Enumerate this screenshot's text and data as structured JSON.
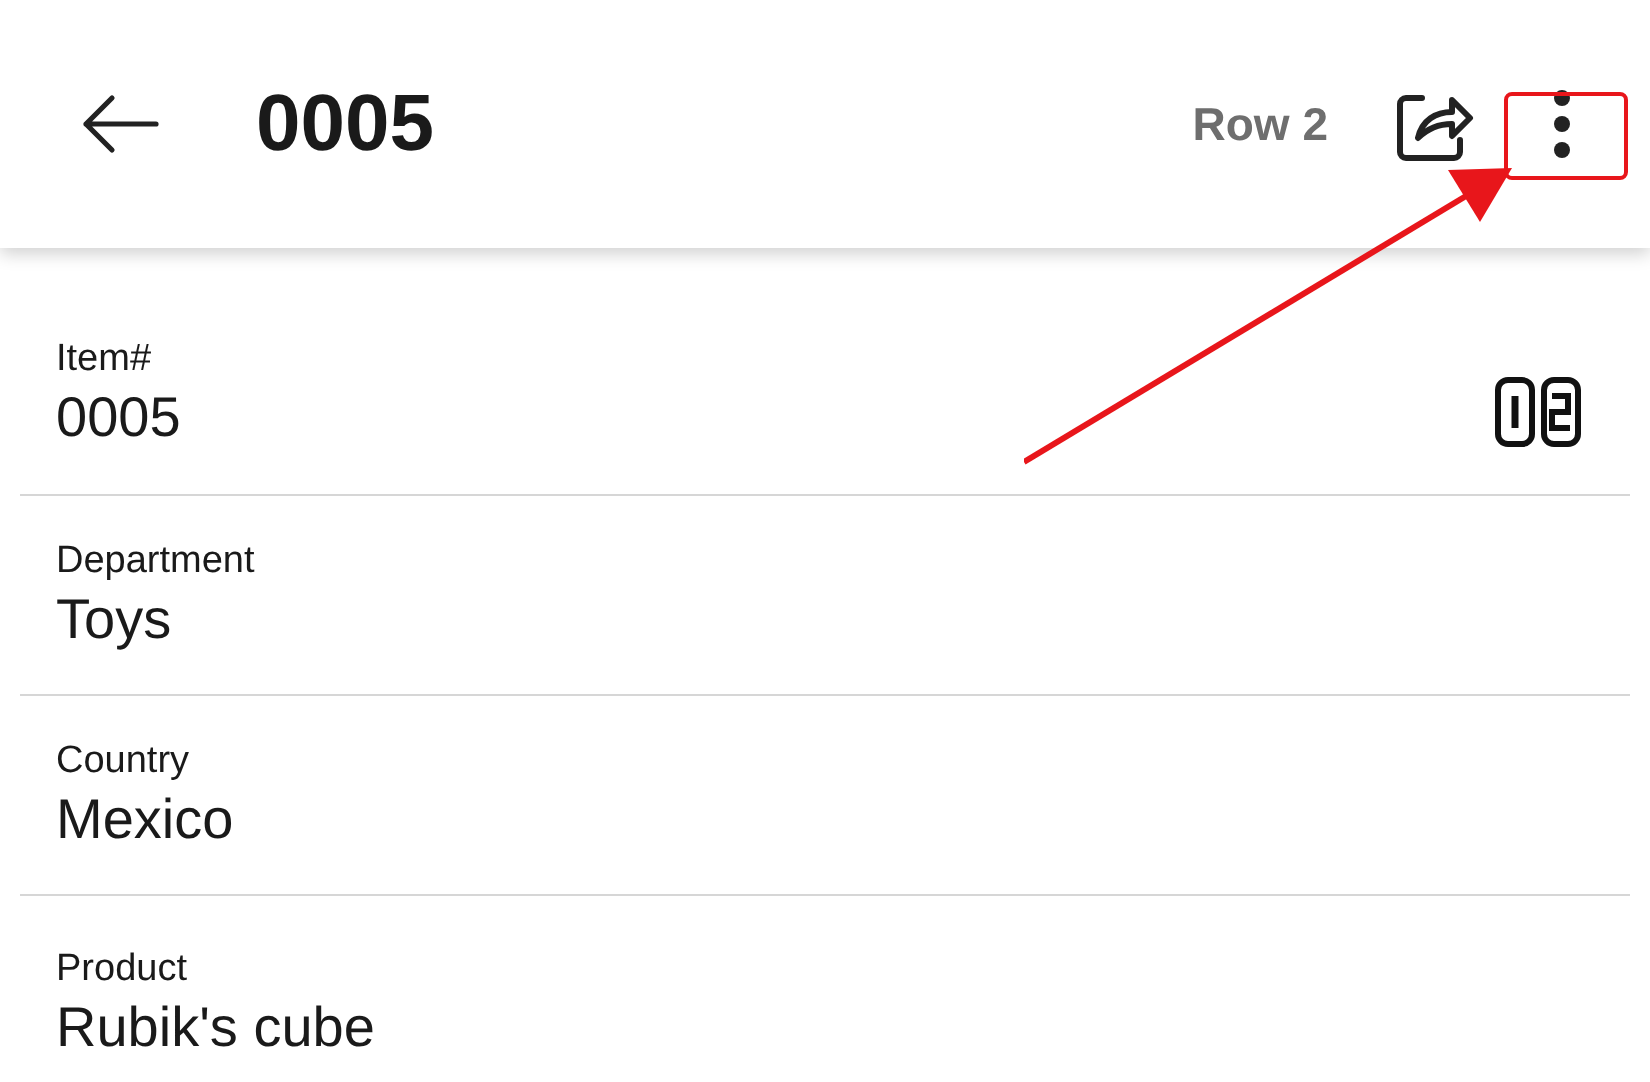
{
  "header": {
    "title": "0005",
    "row_label": "Row 2"
  },
  "fields": [
    {
      "label": "Item#",
      "value": "0005",
      "kind": "numbered"
    },
    {
      "label": "Department",
      "value": "Toys",
      "kind": "plain"
    },
    {
      "label": "Country",
      "value": "Mexico",
      "kind": "plain"
    },
    {
      "label": "Product",
      "value": "Rubik's cube",
      "kind": "plain"
    }
  ]
}
